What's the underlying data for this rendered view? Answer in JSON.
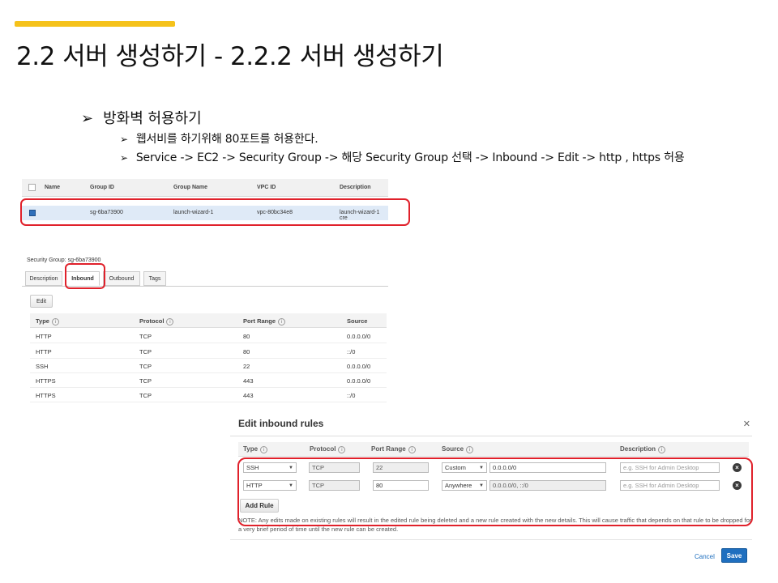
{
  "slide": {
    "title": "2.2 서버 생성하기 - 2.2.2 서버 생성하기",
    "accent_color": "#f5c21b",
    "highlight_color": "#e0212b",
    "bullet_glyph": "➢",
    "bullet1": "방화벽 허용하기",
    "bullet2": "웹서비를 하기위해 80포트를 허용한다.",
    "bullet3": "Service -> EC2 -> Security Group -> 해당 Security Group 선택 -> Inbound -> Edit -> http , https 허용"
  },
  "sg_list": {
    "columns": [
      "Name",
      "Group ID",
      "Group Name",
      "VPC ID",
      "Description"
    ],
    "selected_row": {
      "group_id": "sg-6ba73900",
      "group_name": "launch-wizard-1",
      "vpc_id": "vpc-80bc34e8",
      "description": "launch-wizard-1 cre"
    }
  },
  "detail": {
    "label": "Security Group: sg-6ba73900",
    "tabs": [
      "Description",
      "Inbound",
      "Outbound",
      "Tags"
    ],
    "active_tab": "Inbound",
    "edit_label": "Edit",
    "columns": [
      "Type",
      "Protocol",
      "Port Range",
      "Source"
    ],
    "rules": [
      {
        "type": "HTTP",
        "protocol": "TCP",
        "port": "80",
        "source": "0.0.0.0/0"
      },
      {
        "type": "HTTP",
        "protocol": "TCP",
        "port": "80",
        "source": "::/0"
      },
      {
        "type": "SSH",
        "protocol": "TCP",
        "port": "22",
        "source": "0.0.0.0/0"
      },
      {
        "type": "HTTPS",
        "protocol": "TCP",
        "port": "443",
        "source": "0.0.0.0/0"
      },
      {
        "type": "HTTPS",
        "protocol": "TCP",
        "port": "443",
        "source": "::/0"
      }
    ]
  },
  "modal": {
    "title": "Edit inbound rules",
    "columns": [
      "Type",
      "Protocol",
      "Port Range",
      "Source",
      "Description"
    ],
    "rows": [
      {
        "type": "SSH",
        "protocol": "TCP",
        "port": "22",
        "source_mode": "Custom",
        "source": "0.0.0.0/0",
        "description_placeholder": "e.g. SSH for Admin Desktop"
      },
      {
        "type": "HTTP",
        "protocol": "TCP",
        "port": "80",
        "source_mode": "Anywhere",
        "source": "0.0.0.0/0, ::/0",
        "description_placeholder": "e.g. SSH for Admin Desktop"
      }
    ],
    "add_rule_label": "Add Rule",
    "note": "NOTE: Any edits made on existing rules will result in the edited rule being deleted and a new rule created with the new details. This will cause traffic that depends on that rule to be dropped for a very brief period of time until the new rule can be created.",
    "cancel_label": "Cancel",
    "save_label": "Save"
  }
}
